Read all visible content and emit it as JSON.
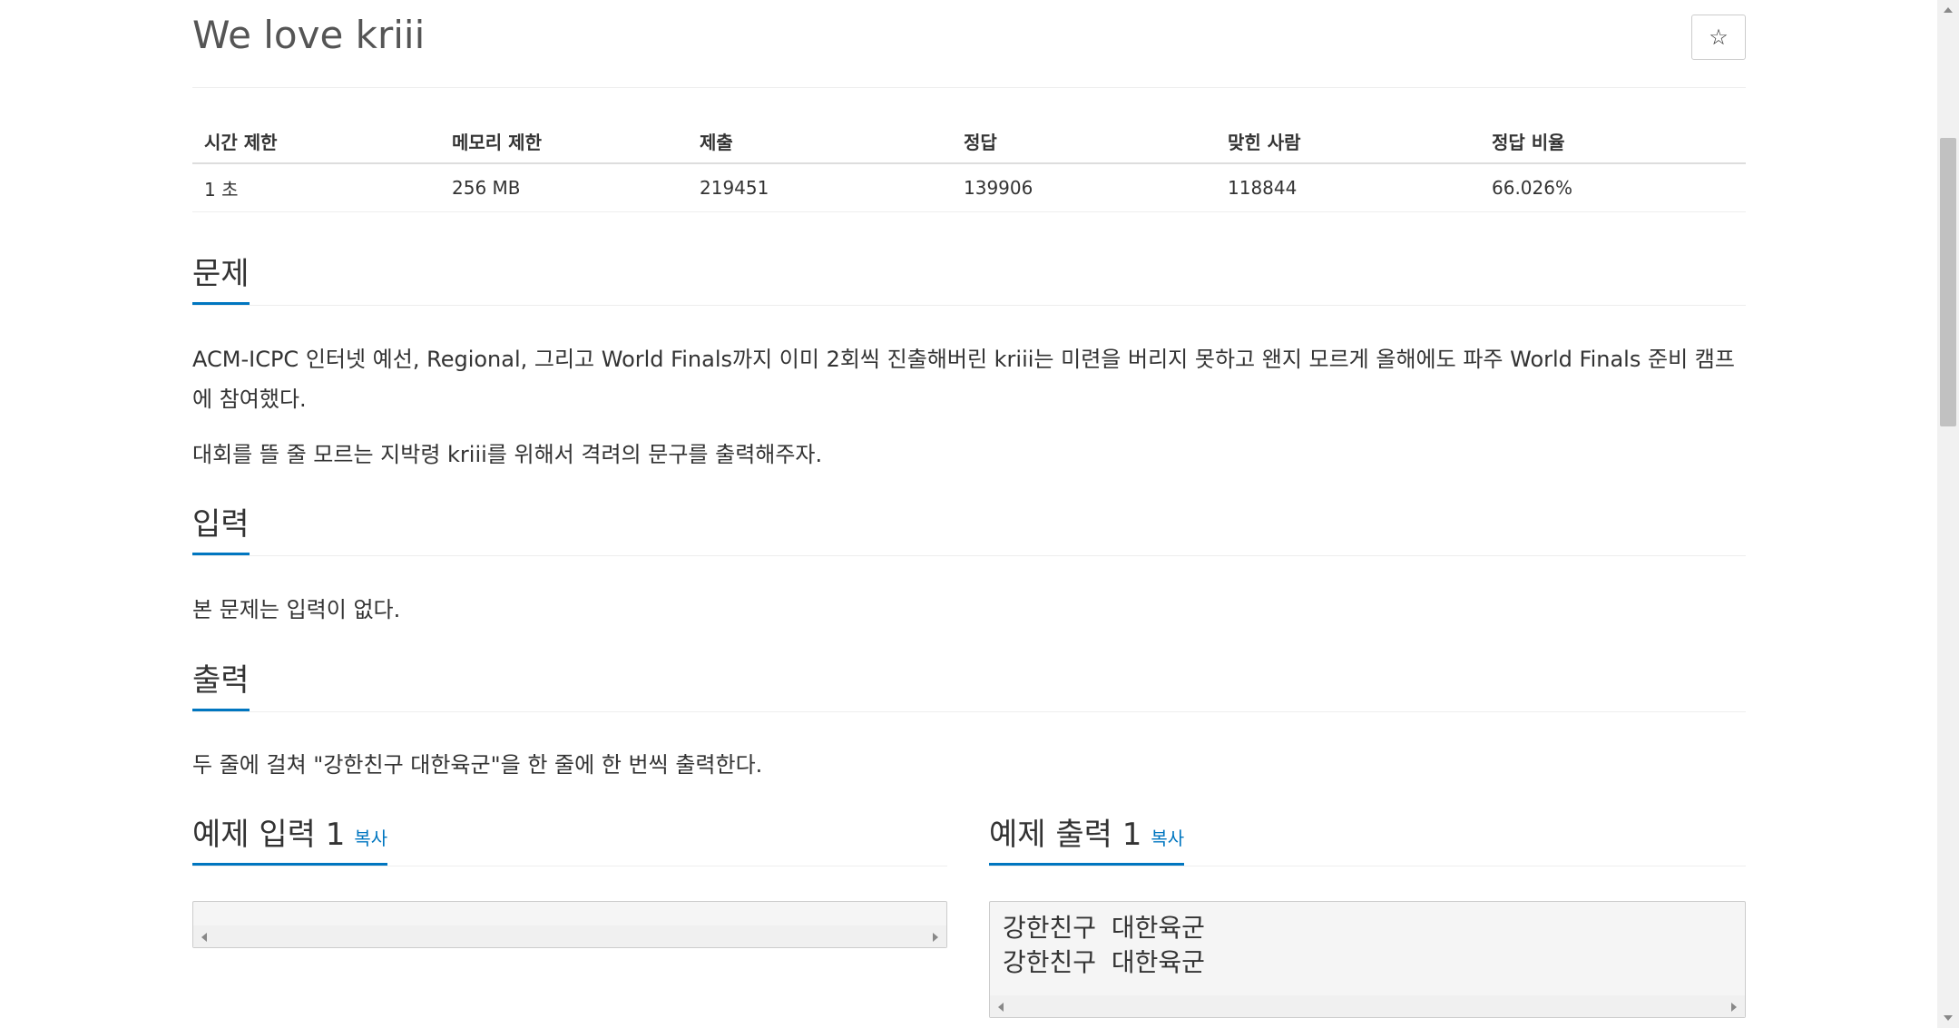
{
  "problem": {
    "title": "We love kriii",
    "star_icon": "☆"
  },
  "info": {
    "headers": [
      "시간 제한",
      "메모리 제한",
      "제출",
      "정답",
      "맞힌 사람",
      "정답 비율"
    ],
    "values": [
      "1 초",
      "256 MB",
      "219451",
      "139906",
      "118844",
      "66.026%"
    ]
  },
  "sections": {
    "description": {
      "heading": "문제",
      "paragraphs": [
        "ACM-ICPC 인터넷 예선, Regional, 그리고 World Finals까지 이미 2회씩 진출해버린 kriii는 미련을 버리지 못하고 왠지 모르게 올해에도 파주 World Finals 준비 캠프에 참여했다.",
        "대회를 뜰 줄 모르는 지박령 kriii를 위해서 격려의 문구를 출력해주자."
      ]
    },
    "input": {
      "heading": "입력",
      "text": "본 문제는 입력이 없다."
    },
    "output": {
      "heading": "출력",
      "text": "두 줄에 걸쳐 \"강한친구 대한육군\"을 한 줄에 한 번씩 출력한다."
    }
  },
  "samples": {
    "copy_label": "복사",
    "input": {
      "heading": "예제 입력 1",
      "content": ""
    },
    "output": {
      "heading": "예제 출력 1",
      "content": "강한친구 대한육군\n강한친구 대한육군"
    }
  }
}
